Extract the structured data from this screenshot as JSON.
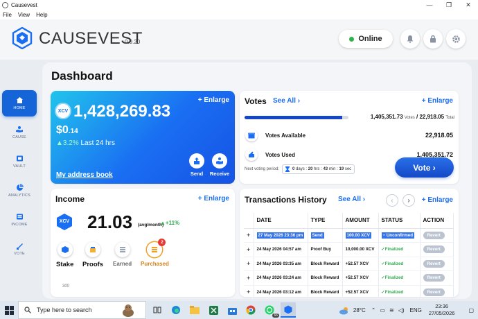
{
  "window": {
    "title": "Causevest",
    "menu": [
      "File",
      "View",
      "Help"
    ]
  },
  "header": {
    "brand": "CAUSEVEST",
    "version": "0.9.20",
    "status": "Online"
  },
  "sidebar": {
    "items": [
      {
        "label": "HOME",
        "icon": "home-icon",
        "active": true
      },
      {
        "label": "CAUSE",
        "icon": "cause-icon"
      },
      {
        "label": "VAULT",
        "icon": "vault-icon"
      },
      {
        "label": "ANALYTICS",
        "icon": "analytics-icon"
      },
      {
        "label": "INCOME",
        "icon": "income-icon"
      },
      {
        "label": "VOTE",
        "icon": "vote-icon"
      }
    ]
  },
  "dashboard": {
    "title": "Dashboard"
  },
  "balance": {
    "enlarge": "Enlarge",
    "badge": "XCV",
    "amount": "1,428,269.83",
    "usd_main": "$0",
    "usd_dec": ".14",
    "change_pct": "3.2%",
    "change_label": "Last 24 hrs",
    "address_book": "My address book",
    "send": "Send",
    "receive": "Receive"
  },
  "votes": {
    "title": "Votes",
    "see_all": "See All",
    "enlarge": "Enlarge",
    "progress_fraction": 0.94,
    "used_count": "1,405,351.73",
    "votes_word": "Votes",
    "total_count": "22,918.05",
    "total_word": "Total",
    "available_label": "Votes Available",
    "available_value": "22,918.05",
    "used_label": "Votes Used",
    "used_value": "1,405,351.72",
    "next_period_label": "Next voting period:",
    "timer": {
      "days": "0",
      "days_lbl": "days :",
      "hrs": "20",
      "hrs_lbl": "hrs :",
      "min": "43",
      "min_lbl": "min :",
      "sec": "19",
      "sec_lbl": "sec"
    },
    "vote_button": "Vote"
  },
  "income": {
    "title": "Income",
    "enlarge": "Enlarge",
    "badge": "XCV",
    "value": "21.03",
    "unit": "(avg/month)",
    "change": "+11%",
    "actions": [
      "Stake",
      "Proofs",
      "Earned",
      "Purchased"
    ],
    "purchased_badge": "2",
    "axis_tick": "300"
  },
  "transactions": {
    "title": "Transactions History",
    "see_all": "See All",
    "enlarge": "Enlarge",
    "columns": [
      "DATE",
      "TYPE",
      "AMOUNT",
      "STATUS",
      "ACTION"
    ],
    "rows": [
      {
        "date": "27 May 2026 23:36 pm",
        "type": "Send",
        "amount": "100.00 XCV",
        "status": "Unconfirmed",
        "action": "Revert"
      },
      {
        "date": "24 May 2026 04:57 am",
        "type": "Proof Buy",
        "amount": "10,000.00 XCV",
        "status": "Finalized",
        "action": "Revert"
      },
      {
        "date": "24 May 2026 03:35 am",
        "type": "Block Reward",
        "amount": "+52.57 XCV",
        "status": "Finalized",
        "action": "Revert"
      },
      {
        "date": "24 May 2026 03:24 am",
        "type": "Block Reward",
        "amount": "+52.57 XCV",
        "status": "Finalized",
        "action": "Revert"
      },
      {
        "date": "24 May 2026 03:12 am",
        "type": "Block Reward",
        "amount": "+52.57 XCV",
        "status": "Finalized",
        "action": "Revert"
      }
    ]
  },
  "taskbar": {
    "search_placeholder": "Type here to search",
    "whatsapp_count": "66",
    "temperature": "28°C",
    "language": "ENG",
    "time": "23:36",
    "date": "27/05/2026"
  },
  "colors": {
    "accent": "#1a6ef2",
    "success": "#2fa84f",
    "danger": "#e53935"
  }
}
